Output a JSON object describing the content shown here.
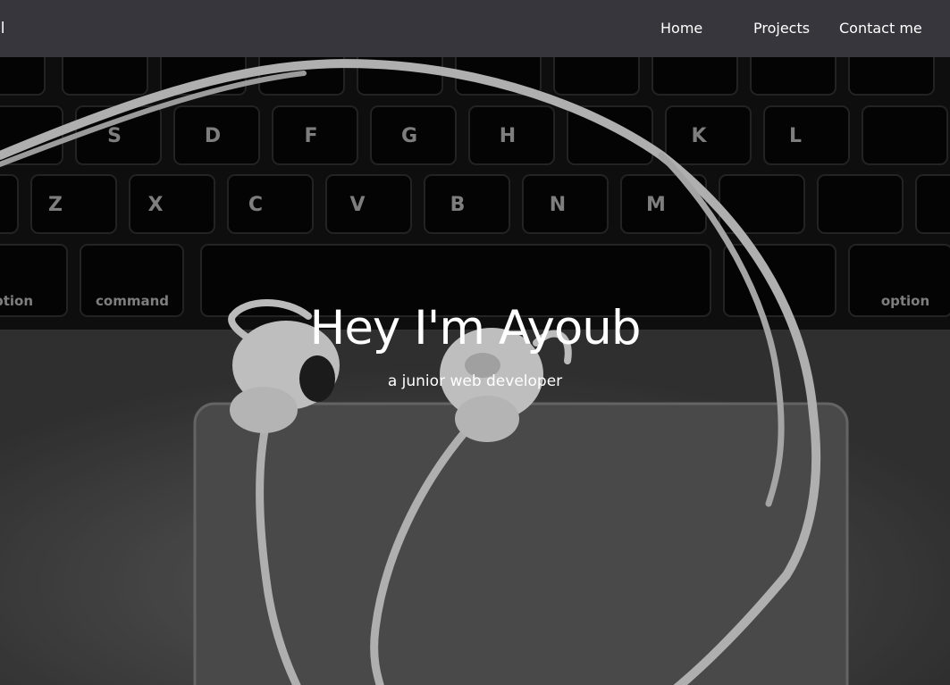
{
  "navbar": {
    "brand": "il",
    "links": [
      {
        "label": "Home"
      },
      {
        "label": "Projects"
      },
      {
        "label": "Contact me"
      }
    ]
  },
  "hero": {
    "title": "Hey I'm Ayoub",
    "subtitle": "a junior web developer",
    "background_image": "laptop-keyboard-with-white-earphones-photo"
  },
  "colors": {
    "navbar_bg": "#38363d",
    "text": "#ffffff"
  }
}
